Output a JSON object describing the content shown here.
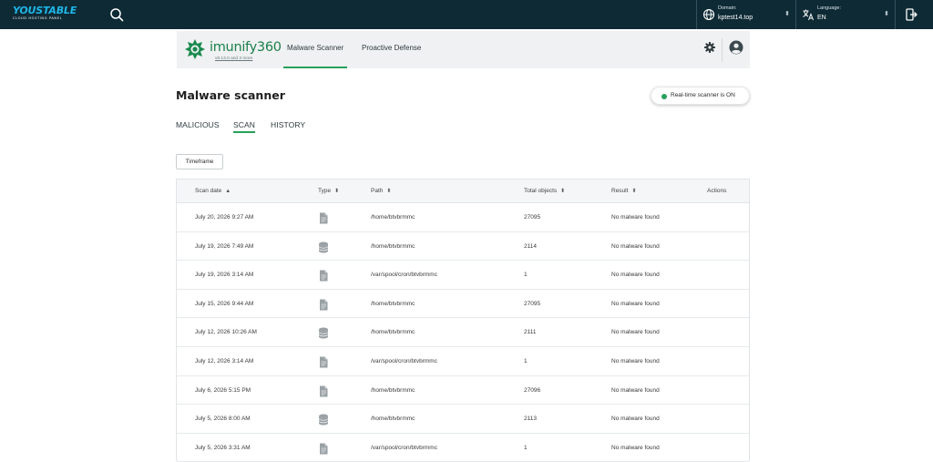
{
  "topbar": {
    "brand": "YOUSTABLE",
    "brand_sub": "CLOUD HOSTING PANEL",
    "domain_label": "Domain:",
    "domain_value": "kptest14.top",
    "language_label": "Language:",
    "language_value": "EN"
  },
  "app": {
    "logo_name": "imunify360",
    "version": "v8.13.0 and 3 more",
    "tabs": [
      {
        "label": "Malware Scanner",
        "active": true
      },
      {
        "label": "Proactive Defense",
        "active": false
      }
    ]
  },
  "page": {
    "title": "Malware scanner",
    "realtime_badge": "Real-time scanner is ON",
    "subtabs": [
      {
        "label": "MALICIOUS",
        "active": false
      },
      {
        "label": "SCAN",
        "active": true
      },
      {
        "label": "HISTORY",
        "active": false
      }
    ],
    "timeframe_label": "Timeframe"
  },
  "table": {
    "columns": [
      {
        "label": "Scan date",
        "sort": "▲"
      },
      {
        "label": "Type",
        "sort": "⬍"
      },
      {
        "label": "Path",
        "sort": "⬍"
      },
      {
        "label": "Total objects",
        "sort": "⬍"
      },
      {
        "label": "Result",
        "sort": "⬍"
      },
      {
        "label": "Actions",
        "sort": ""
      }
    ],
    "rows": [
      {
        "date": "July 20, 2026 9:27 AM",
        "type": "file-icon",
        "path": "/home/btvbrmmc",
        "total": "27095",
        "result": "No malware found"
      },
      {
        "date": "July 19, 2026 7:49 AM",
        "type": "database-icon",
        "path": "/home/btvbrmmc",
        "total": "2114",
        "result": "No malware found"
      },
      {
        "date": "July 19, 2026 3:14 AM",
        "type": "file-icon",
        "path": "/var/spool/cron/btvbrmmc",
        "total": "1",
        "result": "No malware found"
      },
      {
        "date": "July 15, 2026 9:44 AM",
        "type": "file-icon",
        "path": "/home/btvbrmmc",
        "total": "27095",
        "result": "No malware found"
      },
      {
        "date": "July 12, 2026 10:26 AM",
        "type": "database-icon",
        "path": "/home/btvbrmmc",
        "total": "2111",
        "result": "No malware found"
      },
      {
        "date": "July 12, 2026 3:14 AM",
        "type": "file-icon",
        "path": "/var/spool/cron/btvbrmmc",
        "total": "1",
        "result": "No malware found"
      },
      {
        "date": "July 6, 2026 5:15 PM",
        "type": "file-icon",
        "path": "/home/btvbrmmc",
        "total": "27096",
        "result": "No malware found"
      },
      {
        "date": "July 5, 2026 8:00 AM",
        "type": "database-icon",
        "path": "/home/btvbrmmc",
        "total": "2113",
        "result": "No malware found"
      },
      {
        "date": "July 5, 2026 3:31 AM",
        "type": "file-icon",
        "path": "/var/spool/cron/btvbrmmc",
        "total": "1",
        "result": "No malware found"
      }
    ]
  },
  "colors": {
    "topbar_bg": "#0e2a35",
    "accent_green": "#27a05b",
    "brand_blue": "#1fb6e8"
  }
}
